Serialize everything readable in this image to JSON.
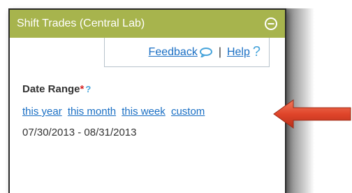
{
  "panel": {
    "title": "Shift Trades (Central Lab)",
    "collapse_icon": "minus-circle-icon"
  },
  "links": {
    "feedback_label": "Feedback",
    "feedback_icon": "speech-bubble-icon",
    "separator": "|",
    "help_label": "Help",
    "help_icon": "?"
  },
  "date_range": {
    "label": "Date Range",
    "required_marker": "*",
    "info_icon": "?",
    "options": [
      "this year",
      "this month",
      "this week",
      "custom"
    ],
    "value": "07/30/2013 - 08/31/2013"
  },
  "colors": {
    "header_bg": "#a7b44d",
    "link": "#1a6fc4",
    "arrow": "#e0452a"
  }
}
